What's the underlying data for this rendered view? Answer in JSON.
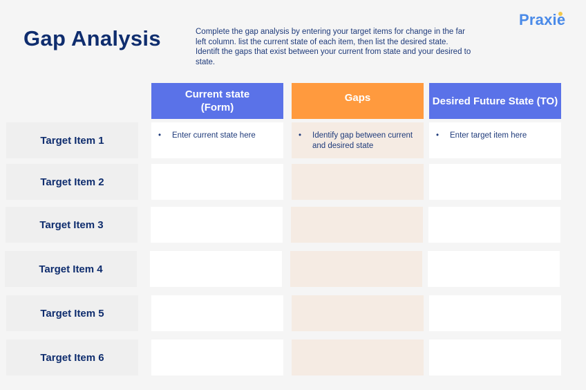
{
  "header": {
    "title": "Gap Analysis",
    "description": "Complete the gap analysis by entering your target items for change in the far left column. list the current state of each item, then list the desired state. Identift the gaps that exist between  your current from state and your desired to state.",
    "logo": "Praxie"
  },
  "columns": {
    "current": "Current state (Form)",
    "gaps": "Gaps",
    "desired": "Desired Future State (TO)"
  },
  "colors": {
    "blue_header": "#5a72e8",
    "orange_header": "#ff9a3e",
    "gap_cell": "#f5ebe3",
    "title_text": "#0f2d6e",
    "logo": "#4a8ae8"
  },
  "rows": [
    {
      "label": "Target Item 1",
      "current": "Enter current state here",
      "gap": "Identify gap between current and desired state",
      "desired": "Enter target item here"
    },
    {
      "label": "Target Item 2",
      "current": "",
      "gap": "",
      "desired": ""
    },
    {
      "label": "Target Item 3",
      "current": "",
      "gap": "",
      "desired": ""
    },
    {
      "label": "Target Item 4",
      "current": "",
      "gap": "",
      "desired": ""
    },
    {
      "label": "Target Item 5",
      "current": "",
      "gap": "",
      "desired": ""
    },
    {
      "label": "Target Item 6",
      "current": "",
      "gap": "",
      "desired": ""
    }
  ],
  "bullet_glyph": "•"
}
